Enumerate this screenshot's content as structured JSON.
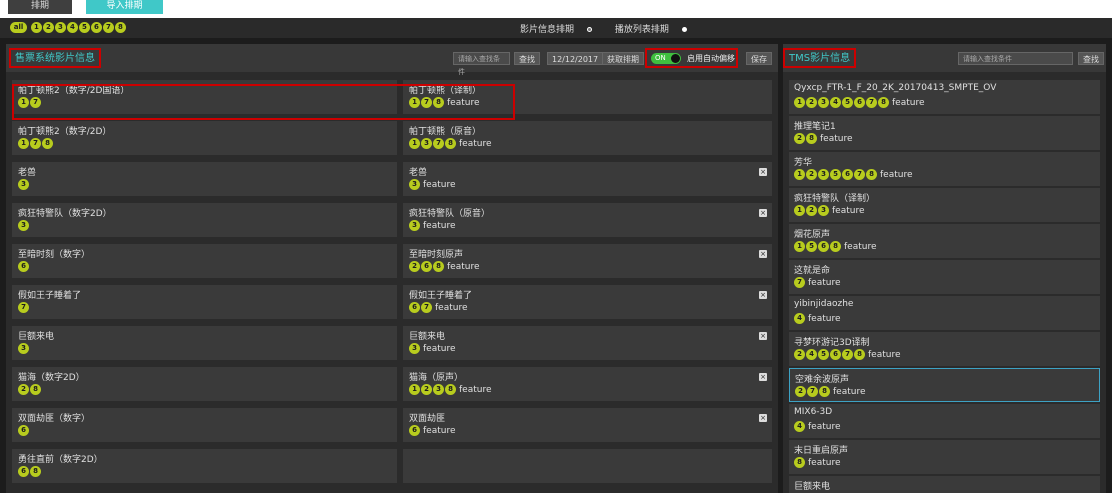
{
  "tabs": {
    "plan": "排期",
    "import": "导入排期"
  },
  "halls": {
    "all": "all",
    "numbers": [
      "1",
      "2",
      "3",
      "4",
      "5",
      "6",
      "7",
      "8"
    ]
  },
  "view_modes": {
    "film_info": "影片信息排期",
    "playlist": "播放列表排期"
  },
  "left_panel": {
    "title": "售票系统影片信息",
    "search_placeholder": "请输入查找条件",
    "search_btn": "查找",
    "date": "12/12/2017",
    "fetch_btn": "获取排期",
    "toggle_on": "ON",
    "auto_label": "启用自动偏移",
    "save_btn": "保存",
    "rows": [
      {
        "left_name": "帕丁顿熊2（数字/2D国语）",
        "left_halls": [
          "1",
          "7"
        ],
        "right_name": "帕丁顿熊（译制）",
        "right_halls": [
          "1",
          "7",
          "8"
        ],
        "feature": "feature",
        "close": false
      },
      {
        "left_name": "帕丁顿熊2（数字/2D）",
        "left_halls": [
          "1",
          "7",
          "8"
        ],
        "right_name": "帕丁顿熊（原音）",
        "right_halls": [
          "1",
          "3",
          "7",
          "8"
        ],
        "feature": "feature",
        "close": false
      },
      {
        "left_name": "老兽",
        "left_halls": [
          "3"
        ],
        "right_name": "老兽",
        "right_halls": [
          "3"
        ],
        "feature": "feature",
        "close": true
      },
      {
        "left_name": "疯狂特警队（数字2D）",
        "left_halls": [
          "3"
        ],
        "right_name": "疯狂特警队（原音）",
        "right_halls": [
          "3"
        ],
        "feature": "feature",
        "close": true
      },
      {
        "left_name": "至暗时刻（数字）",
        "left_halls": [
          "6"
        ],
        "right_name": "至暗时刻原声",
        "right_halls": [
          "2",
          "6",
          "8"
        ],
        "feature": "feature",
        "close": true
      },
      {
        "left_name": "假如王子睡着了",
        "left_halls": [
          "7"
        ],
        "right_name": "假如王子睡着了",
        "right_halls": [
          "6",
          "7"
        ],
        "feature": "feature",
        "close": true
      },
      {
        "left_name": "巨额来电",
        "left_halls": [
          "3"
        ],
        "right_name": "巨额来电",
        "right_halls": [
          "3"
        ],
        "feature": "feature",
        "close": true
      },
      {
        "left_name": "猫海（数字2D）",
        "left_halls": [
          "2",
          "8"
        ],
        "right_name": "猫海（原声）",
        "right_halls": [
          "1",
          "2",
          "3",
          "8"
        ],
        "feature": "feature",
        "close": true
      },
      {
        "left_name": "双面劫匪（数字）",
        "left_halls": [
          "6"
        ],
        "right_name": "双面劫匪",
        "right_halls": [
          "6"
        ],
        "feature": "feature",
        "close": true
      },
      {
        "left_name": "勇往直前（数字2D）",
        "left_halls": [
          "6",
          "8"
        ],
        "right_name": "",
        "right_halls": [],
        "feature": "",
        "close": false
      }
    ]
  },
  "right_panel": {
    "title": "TMS影片信息",
    "search_placeholder": "请输入查找条件",
    "search_btn": "查找",
    "items": [
      {
        "name": "Qyxcp_FTR-1_F_20_2K_20170413_SMPTE_OV",
        "halls": [
          "1",
          "2",
          "3",
          "4",
          "5",
          "6",
          "7",
          "8"
        ],
        "feature": "feature",
        "selected": false
      },
      {
        "name": "推理笔记1",
        "halls": [
          "2",
          "8"
        ],
        "feature": "feature",
        "selected": false
      },
      {
        "name": "芳华",
        "halls": [
          "1",
          "2",
          "3",
          "5",
          "6",
          "7",
          "8"
        ],
        "feature": "feature",
        "selected": false
      },
      {
        "name": "疯狂特警队（译制）",
        "halls": [
          "1",
          "2",
          "3"
        ],
        "feature": "feature",
        "selected": false
      },
      {
        "name": "烟花原声",
        "halls": [
          "1",
          "5",
          "6",
          "8"
        ],
        "feature": "feature",
        "selected": false
      },
      {
        "name": "这就是命",
        "halls": [
          "7"
        ],
        "feature": "feature",
        "selected": false
      },
      {
        "name": "yibinjidaozhe",
        "halls": [
          "4"
        ],
        "feature": "feature",
        "selected": false
      },
      {
        "name": "寻梦环游记3D译制",
        "halls": [
          "2",
          "4",
          "5",
          "6",
          "7",
          "8"
        ],
        "feature": "feature",
        "selected": false
      },
      {
        "name": "空难余波原声",
        "halls": [
          "2",
          "7",
          "8"
        ],
        "feature": "feature",
        "selected": true
      },
      {
        "name": "MIX6-3D",
        "halls": [
          "4"
        ],
        "feature": "feature",
        "selected": false
      },
      {
        "name": "末日重启原声",
        "halls": [
          "8"
        ],
        "feature": "feature",
        "selected": false
      },
      {
        "name": "巨额来电",
        "halls": [],
        "feature": "",
        "selected": false
      }
    ]
  }
}
